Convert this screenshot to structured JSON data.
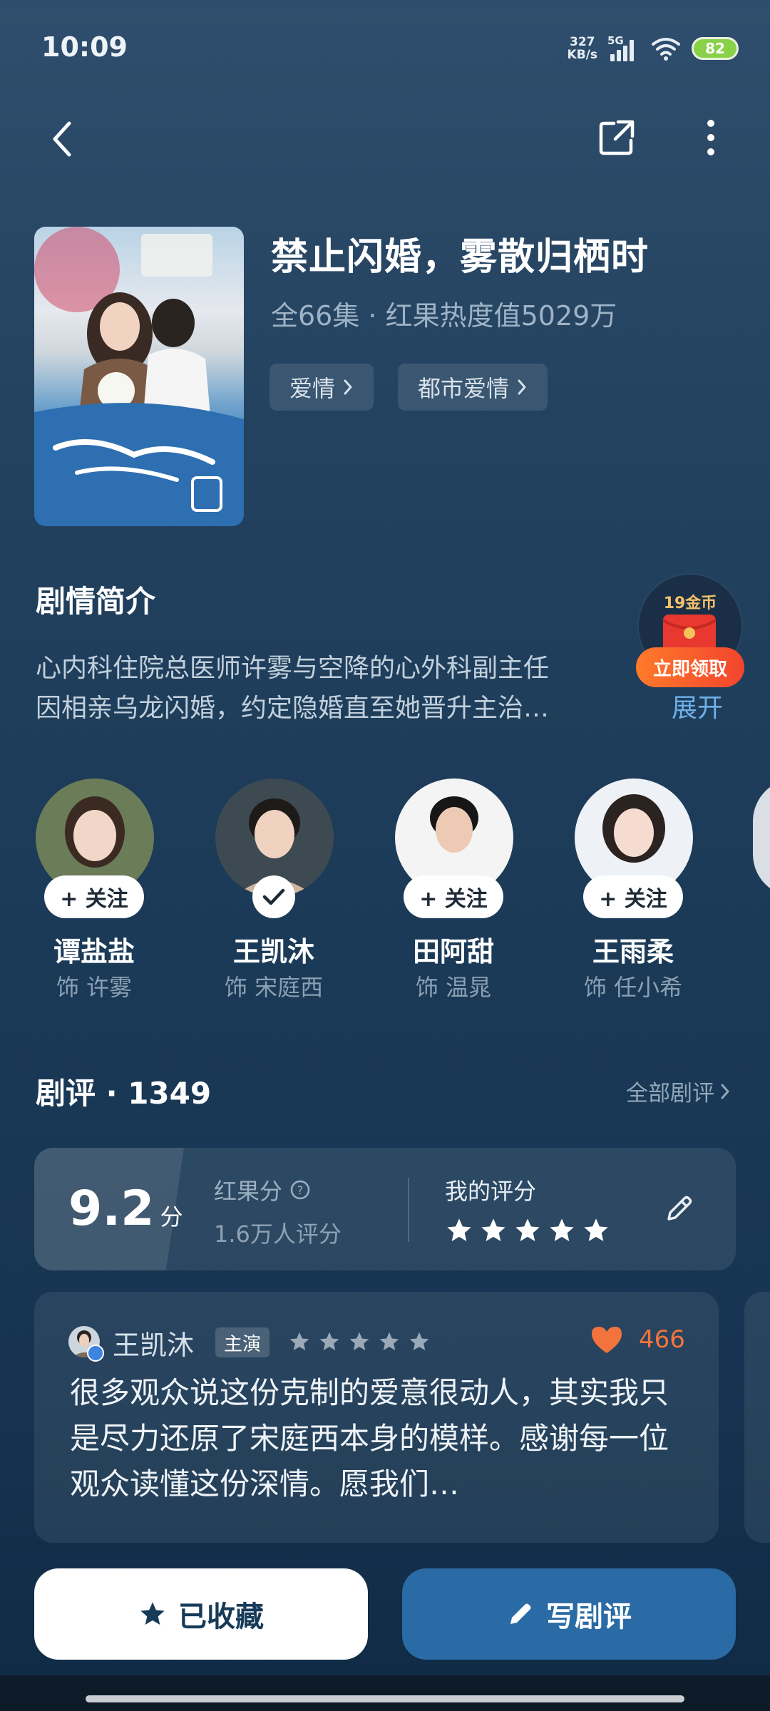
{
  "status_bar": {
    "time": "10:09",
    "net_speed_value": "327",
    "net_speed_unit": "KB/s",
    "network": "5G",
    "battery": "82"
  },
  "show": {
    "title": "禁止闪婚，雾散归栖时",
    "meta": "全66集 · 红果热度值5029万",
    "tags": [
      {
        "label": "爱情"
      },
      {
        "label": "都市爱情"
      }
    ]
  },
  "synopsis": {
    "heading": "剧情简介",
    "line1": "心内科住院总医师许雾与空降的心外科副主任",
    "line2": "因相亲乌龙闪婚，约定隐婚直至她晋升主治…",
    "expand": "展开"
  },
  "coin_reward": {
    "amount": "19金币",
    "claim": "立即领取"
  },
  "cast": [
    {
      "name": "谭盐盐",
      "role": "饰 许雾",
      "follow": "+ 关注",
      "followed": false
    },
    {
      "name": "王凯沐",
      "role": "饰 宋庭西",
      "follow": "",
      "followed": true
    },
    {
      "name": "田阿甜",
      "role": "饰 温晁",
      "follow": "+ 关注",
      "followed": false
    },
    {
      "name": "王雨柔",
      "role": "饰 任小希",
      "follow": "+ 关注",
      "followed": false
    }
  ],
  "reviews": {
    "heading": "剧评 · 1349",
    "all": "全部剧评",
    "score": "9.2",
    "score_unit": "分",
    "score_label": "红果分",
    "raters": "1.6万人评分",
    "my_rating_label": "我的评分",
    "my_rating_stars": 5,
    "review": {
      "author": "王凯沐",
      "badge": "主演",
      "stars": 5,
      "likes": "466",
      "text": "很多观众说这份克制的爱意很动人，其实我只是尽力还原了宋庭西本身的模样。感谢每一位观众读懂这份深情。愿我们…"
    }
  },
  "actions": {
    "favorite": "已收藏",
    "write_review": "写剧评"
  },
  "colors": {
    "accent_blue": "#2a6ba5",
    "link_blue": "#6fb0ea",
    "like_orange": "#f2743c",
    "claim_orange": "#ff7a2a"
  }
}
